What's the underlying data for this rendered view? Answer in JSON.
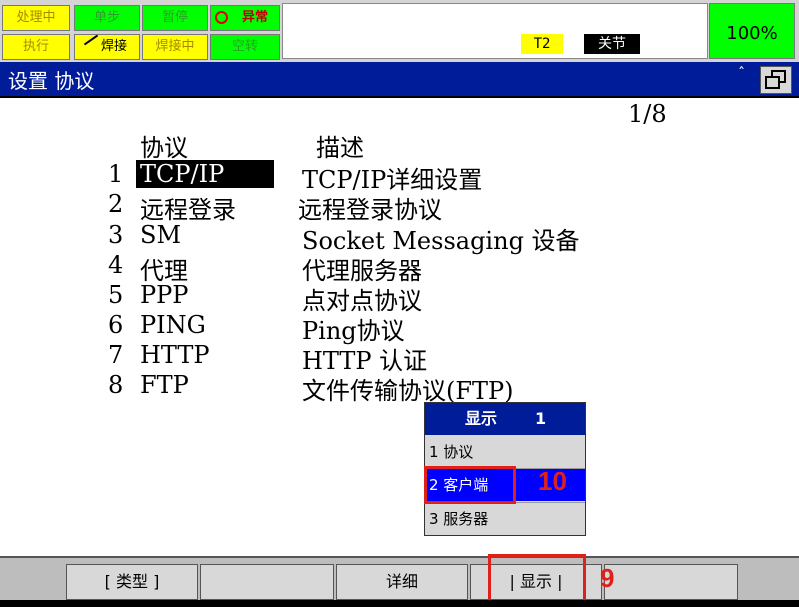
{
  "status": {
    "row1": [
      "处理中",
      "单步",
      "暂停",
      "异常"
    ],
    "row2": [
      "执行",
      "焊接",
      "焊接中",
      "空转"
    ],
    "mode": "T2",
    "state": "关节",
    "override": "100%"
  },
  "title": "设置 协议",
  "scroll_caret": "ˆ",
  "page_indicator": "1/8",
  "columns": {
    "protocol": "协议",
    "description": "描述"
  },
  "rows": [
    {
      "num": "1",
      "name": "TCP/IP",
      "desc": "TCP/IP详细设置"
    },
    {
      "num": "2",
      "name": "远程登录",
      "desc": "远程登录协议"
    },
    {
      "num": "3",
      "name": "SM",
      "desc": "Socket Messaging 设备"
    },
    {
      "num": "4",
      "name": "代理",
      "desc": "代理服务器"
    },
    {
      "num": "5",
      "name": "PPP",
      "desc": "点对点协议"
    },
    {
      "num": "6",
      "name": "PING",
      "desc": "Ping协议"
    },
    {
      "num": "7",
      "name": "HTTP",
      "desc": "HTTP 认证"
    },
    {
      "num": "8",
      "name": "FTP",
      "desc": "文件传输协议(FTP)"
    }
  ],
  "popup": {
    "title": "显示",
    "page": "1",
    "items": [
      "1 协议",
      "2 客户端",
      "3 服务器"
    ]
  },
  "annotations": {
    "popup_step": "10",
    "fkey_step": "9"
  },
  "fkeys": [
    "[ 类型 ]",
    "",
    "详细",
    "| 显示 |",
    ""
  ],
  "colors": {
    "title_bar": "#001c99",
    "highlight": "#0000ff",
    "annotation": "#e0201a"
  }
}
